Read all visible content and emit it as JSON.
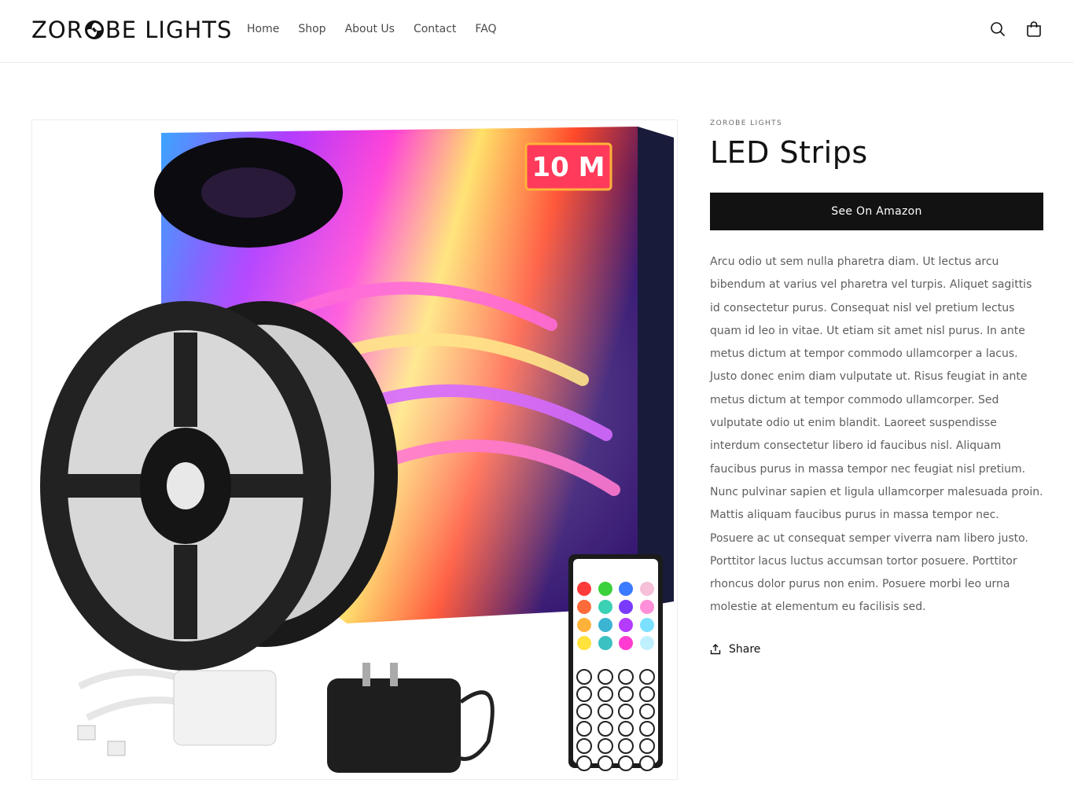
{
  "brand": {
    "logo_left": "ZOR",
    "logo_right": "BE LIGHTS"
  },
  "nav": {
    "items": [
      "Home",
      "Shop",
      "About Us",
      "Contact",
      "FAQ"
    ]
  },
  "header": {
    "search_icon": "search-icon",
    "cart_icon": "cart-icon"
  },
  "product": {
    "vendor": "ZOROBE LIGHTS",
    "title": "LED Strips",
    "buy_label": "See On Amazon",
    "description": "Arcu odio ut sem nulla pharetra diam. Ut lectus arcu bibendum at varius vel pharetra vel turpis. Aliquet sagittis id consectetur purus. Consequat nisl vel pretium lectus quam id leo in vitae. Ut etiam sit amet nisl purus. In ante metus dictum at tempor commodo ullamcorper a lacus. Justo donec enim diam vulputate ut. Risus feugiat in ante metus dictum at tempor commodo ullamcorper. Sed vulputate odio ut enim blandit. Laoreet suspendisse interdum consectetur libero id faucibus nisl. Aliquam faucibus purus in massa tempor nec feugiat nisl pretium. Nunc pulvinar sapien et ligula ullamcorper malesuada proin. Mattis aliquam faucibus purus in massa tempor nec. Posuere ac ut consequat semper viverra nam libero justo. Porttitor lacus luctus accumsan tortor posuere. Porttitor rhoncus dolor purus non enim. Posuere morbi leo urna molestie at elementum eu facilisis sed.",
    "share_label": "Share",
    "image_badge": "10 M"
  },
  "colors": {
    "button_bg": "#121212",
    "button_text": "#ffffff",
    "text_muted": "#5e5e5e"
  }
}
